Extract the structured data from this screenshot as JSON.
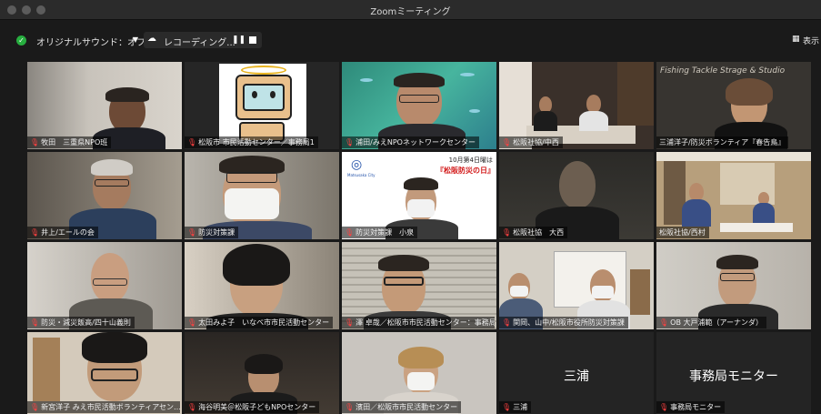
{
  "window": {
    "title": "Zoomミーティング"
  },
  "toolbar": {
    "audio_label": "オリジナルサウンド：オフ",
    "recording_label": "レコーディング...",
    "view_label": "表示"
  },
  "participants": [
    {
      "name": "牧田　三重県NPO班",
      "muted": true
    },
    {
      "name": "松阪市 市民活動センター／事務局1",
      "muted": true
    },
    {
      "name": "浦田/みえNPOネットワークセンター",
      "muted": true
    },
    {
      "name": "松阪社協/中西",
      "muted": true
    },
    {
      "name": "三浦洋子/防災ボランティア『春告鳥』",
      "muted": false
    },
    {
      "name": "井上/エールの会",
      "muted": true
    },
    {
      "name": "防災対策課",
      "muted": true
    },
    {
      "name": "防災対策課　小泉",
      "muted": true
    },
    {
      "name": "松阪社協　大西",
      "muted": true
    },
    {
      "name": "松阪社協/西村",
      "muted": false,
      "active": true
    },
    {
      "name": "防災・減災飯高/四十山義則",
      "muted": true
    },
    {
      "name": "太田みよ子　いなべ市市民活動センター",
      "muted": true
    },
    {
      "name": "澤 卓哉／松阪市市民活動センター：事務局",
      "muted": true
    },
    {
      "name": "関岡、山中/松阪市役所防災対策課",
      "muted": true
    },
    {
      "name": "OB 大戸浦範（アーナンダ）",
      "muted": true
    },
    {
      "name": "新宮洋子 みえ市民活動ボランティアセン…",
      "muted": true
    },
    {
      "name": "海谷明美＠松阪子どもNPOセンター",
      "muted": true
    },
    {
      "name": "濱田／松阪市市民活動センター",
      "muted": true
    },
    {
      "name": "三浦",
      "muted": true,
      "video_off": true
    },
    {
      "name": "事務局モニター",
      "muted": true,
      "video_off": true
    }
  ],
  "slide": {
    "line1": "10月第4日曜は",
    "line2": "『松阪防災の日』",
    "logo": "Matsusaka City"
  },
  "wall_text": "Fishing Tackle Strage & Studio"
}
